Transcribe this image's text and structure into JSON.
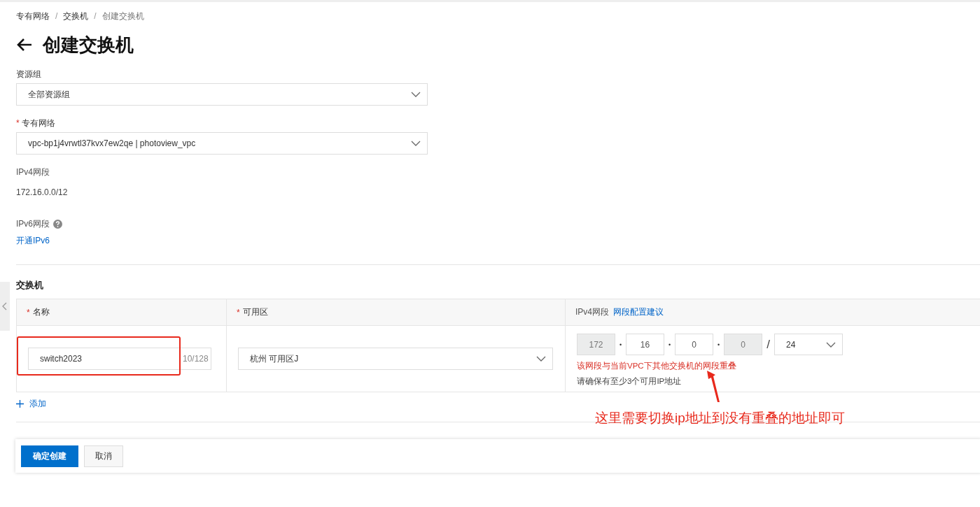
{
  "breadcrumb": [
    {
      "label": "专有网络",
      "current": false
    },
    {
      "separator": "/",
      "label": "交换机",
      "current": false
    },
    {
      "separator": "/",
      "label": "创建交换机",
      "current": true
    }
  ],
  "page_title": "创建交换机",
  "resource_group": {
    "label": "资源组",
    "value": "全部资源组"
  },
  "vpc": {
    "mark": "*",
    "label": "专有网络",
    "value": "vpc-bp1j4vrwtl37kvx7ew2qe | photoview_vpc"
  },
  "ipv4": {
    "label": "IPv4网段",
    "value": "172.16.0.0/12"
  },
  "ipv6": {
    "label": "IPv6网段",
    "link": "开通IPv6"
  },
  "switch_section": {
    "title": "交换机",
    "columns": [
      {
        "mark": "*",
        "label": "名称"
      },
      {
        "mark": "*",
        "label": "可用区"
      },
      {
        "label": "IPv4网段",
        "link": "网段配置建议"
      }
    ],
    "rows": [
      {
        "name": "switch2023",
        "count": "10/128",
        "zone": "杭州 可用区J",
        "octets": [
          {
            "value": "172",
            "disabled": true
          },
          {
            "separator": "•",
            "value": "16",
            "disabled": false
          },
          {
            "separator": "•",
            "value": "0",
            "disabled": false
          },
          {
            "separator": "•",
            "value": "0",
            "disabled": true
          }
        ],
        "mask_separator": "/",
        "mask": "24",
        "error": "该网段与当前VPC下其他交换机的网段重叠",
        "hint": "请确保有至少3个可用IP地址"
      }
    ],
    "add": "添加"
  },
  "annotation": "这里需要切换ip地址到没有重叠的地址即可",
  "buttons": [
    {
      "label": "确定创建",
      "kind": "primary"
    },
    {
      "label": "取消",
      "kind": "default"
    }
  ]
}
